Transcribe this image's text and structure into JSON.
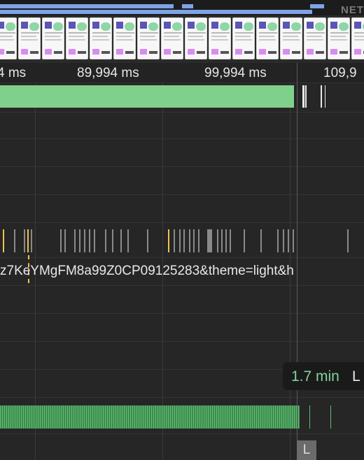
{
  "network": {
    "label": "NET"
  },
  "ruler": {
    "ticks": [
      "4 ms",
      "89,994 ms",
      "99,994 ms",
      "109,9"
    ]
  },
  "track": {
    "url_fragment": "z7KeYMgFM8a99Z0CP09125283&theme=light&h"
  },
  "tooltip": {
    "value": "1.7 min",
    "suffix": "L"
  },
  "marker": {
    "label": "L"
  },
  "colors": {
    "activity": "#7fd08b",
    "network": "#7ea3e6",
    "event_highlight": "#f2c14e",
    "frames": "#5fbf72"
  }
}
